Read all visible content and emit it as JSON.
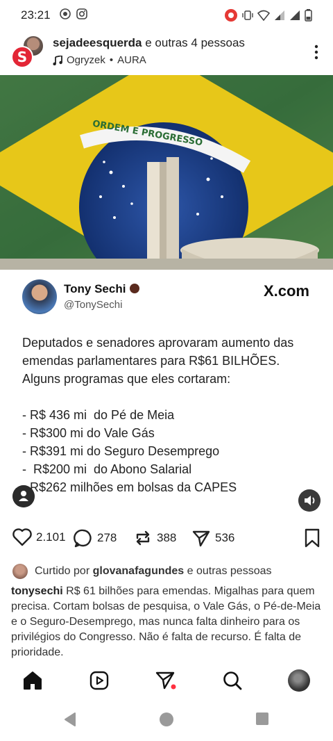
{
  "status_bar": {
    "time": "23:21",
    "icons_left": [
      "notification-icon",
      "instagram-icon"
    ],
    "icons_right": [
      "record-icon",
      "vibrate-icon",
      "wifi-icon",
      "signal-icon",
      "signal-icon",
      "battery-icon"
    ]
  },
  "post": {
    "author": "sejadeesquerda",
    "collab_text": "e outras 4 pessoas",
    "music_artist": "Ogryzek",
    "music_title": "AURA",
    "music_separator": "•"
  },
  "media": {
    "flag_motto": "ORDEM E PROGRESSO",
    "tweet": {
      "name": "Tony Sechi",
      "handle": "@TonySechi",
      "site_label": "X.com",
      "lines": [
        "Deputados e senadores aprovaram aumento das",
        "emendas parlamentares para R$61 BILHÕES.",
        "Alguns programas que eles cortaram:",
        "",
        "- R$ 436 mi  do Pé de Meia",
        "- R$300 mi do Vale Gás",
        "- R$391 mi do Seguro Desemprego",
        "-  R$200 mi  do Abono Salarial",
        "- R$262 milhões em bolsas da CAPES"
      ]
    }
  },
  "actions": {
    "likes": "2.101",
    "comments": "278",
    "reposts": "388",
    "shares": "536"
  },
  "liked_by": {
    "prefix": "Curtido por",
    "user": "glovanafagundes",
    "suffix": "e outras pessoas"
  },
  "caption": {
    "user": "tonysechi",
    "text": "R$ 61 bilhões para emendas. Migalhas para quem precisa. Cortam bolsas de pesquisa, o Vale Gás, o Pé-de-Meia e o Seguro-Desemprego, mas nunca falta dinheiro para os privilégios do Congresso. Não é falta de recurso. É falta de prioridade."
  },
  "bottom_nav": [
    "home-icon",
    "reels-icon",
    "send-icon",
    "search-icon",
    "profile-avatar"
  ],
  "colors": {
    "flag_green": "#2e8b3c",
    "flag_yellow": "#f2d21b",
    "flag_blue": "#1f3f8f",
    "accent_red": "#e32636",
    "notification_dot": "#ff3040"
  }
}
